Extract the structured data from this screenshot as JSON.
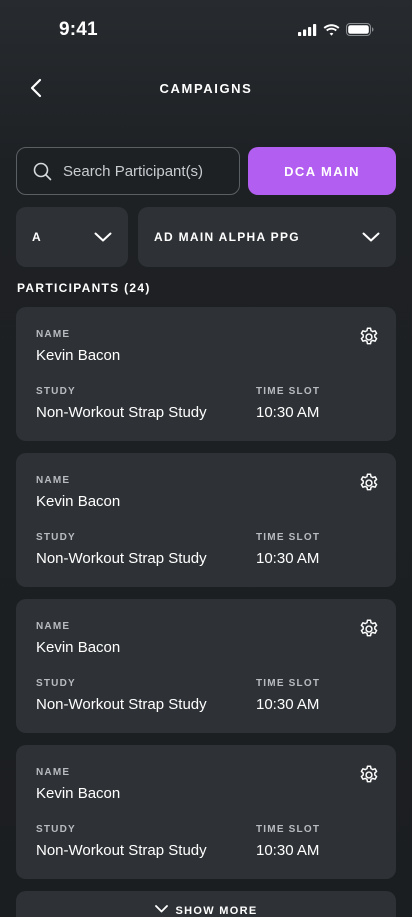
{
  "status_bar": {
    "time": "9:41"
  },
  "header": {
    "title": "CAMPAIGNS"
  },
  "search": {
    "placeholder": "Search Participant(s)",
    "value": ""
  },
  "primary_action": {
    "label": "DCA MAIN",
    "color": "#b25ef0"
  },
  "filters": {
    "group": {
      "value": "A"
    },
    "campaign": {
      "value": "AD MAIN ALPHA PPG"
    }
  },
  "participants": {
    "heading": "PARTICIPANTS (24)",
    "labels": {
      "name": "NAME",
      "study": "STUDY",
      "time_slot": "TIME SLOT"
    },
    "items": [
      {
        "name": "Kevin Bacon",
        "study": "Non-Workout Strap Study",
        "time_slot": "10:30 AM"
      },
      {
        "name": "Kevin Bacon",
        "study": "Non-Workout Strap Study",
        "time_slot": "10:30 AM"
      },
      {
        "name": "Kevin Bacon",
        "study": "Non-Workout Strap Study",
        "time_slot": "10:30 AM"
      },
      {
        "name": "Kevin Bacon",
        "study": "Non-Workout Strap Study",
        "time_slot": "10:30 AM"
      }
    ],
    "show_more": "SHOW MORE"
  },
  "icons": {
    "back": "chevron-left-icon",
    "search": "search-icon",
    "dropdown": "chevron-down-icon",
    "settings": "gear-icon"
  }
}
